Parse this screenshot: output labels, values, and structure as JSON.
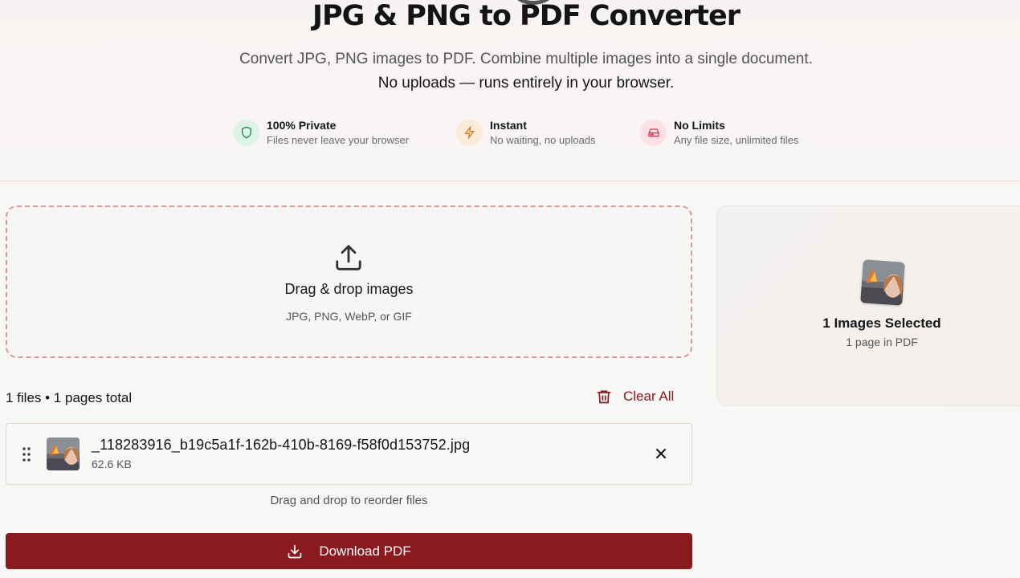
{
  "hero": {
    "title": "JPG & PNG to PDF Converter",
    "subtitle": "Convert JPG, PNG images to PDF. Combine multiple images into a single document.",
    "subtitle_emphasis": "No uploads — runs entirely in your browser.",
    "features": [
      {
        "title": "100% Private",
        "desc": "Files never leave your browser",
        "icon": "shield-icon",
        "color": "#1a8a5a"
      },
      {
        "title": "Instant",
        "desc": "No waiting, no uploads",
        "icon": "bolt-icon",
        "color": "#e07a1a"
      },
      {
        "title": "No Limits",
        "desc": "Any file size, unlimited files",
        "icon": "drive-icon",
        "color": "#d43a55"
      }
    ]
  },
  "dropzone": {
    "title": "Drag & drop images",
    "formats": "JPG, PNG, WebP, or GIF",
    "icon": "upload-icon"
  },
  "files": {
    "summary": "1 files • 1 pages total",
    "clear_label": "Clear All",
    "items": [
      {
        "name": "_118283916_b19c5a1f-162b-410b-8169-f58f0d153752.jpg",
        "size": "62.6 KB"
      }
    ],
    "reorder_hint": "Drag and drop to reorder files"
  },
  "download": {
    "label": "Download PDF",
    "icon": "download-icon"
  },
  "selection": {
    "title": "1 Images Selected",
    "subtitle": "1 page in PDF"
  },
  "colors": {
    "accent": "#8b1a1f",
    "dropzone_border": "#d49a9a"
  }
}
